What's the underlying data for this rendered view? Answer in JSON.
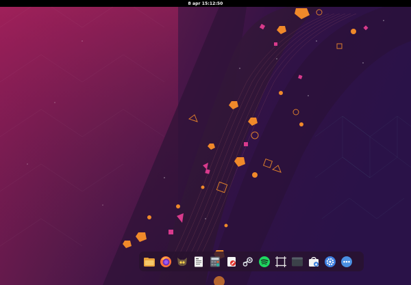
{
  "topbar": {
    "clock": "8 apr 15:12:50"
  },
  "colors": {
    "topbar_bg": "#000000",
    "wallpaper_left": "#8c1b55",
    "wallpaper_right": "#2a1248",
    "accent_orange": "#f0892a",
    "accent_magenta": "#d83a8c"
  },
  "dock": {
    "items": [
      {
        "icon": "file-manager-icon"
      },
      {
        "icon": "firefox-icon"
      },
      {
        "icon": "gimp-icon"
      },
      {
        "icon": "text-document-icon"
      },
      {
        "icon": "calculator-icon"
      },
      {
        "icon": "software-store-icon"
      },
      {
        "icon": "steam-icon"
      },
      {
        "icon": "spotify-icon"
      },
      {
        "icon": "screenshot-icon"
      },
      {
        "icon": "terminal-icon"
      },
      {
        "icon": "shopping-bag-icon"
      },
      {
        "icon": "settings-icon"
      },
      {
        "icon": "show-applications-icon"
      }
    ]
  }
}
